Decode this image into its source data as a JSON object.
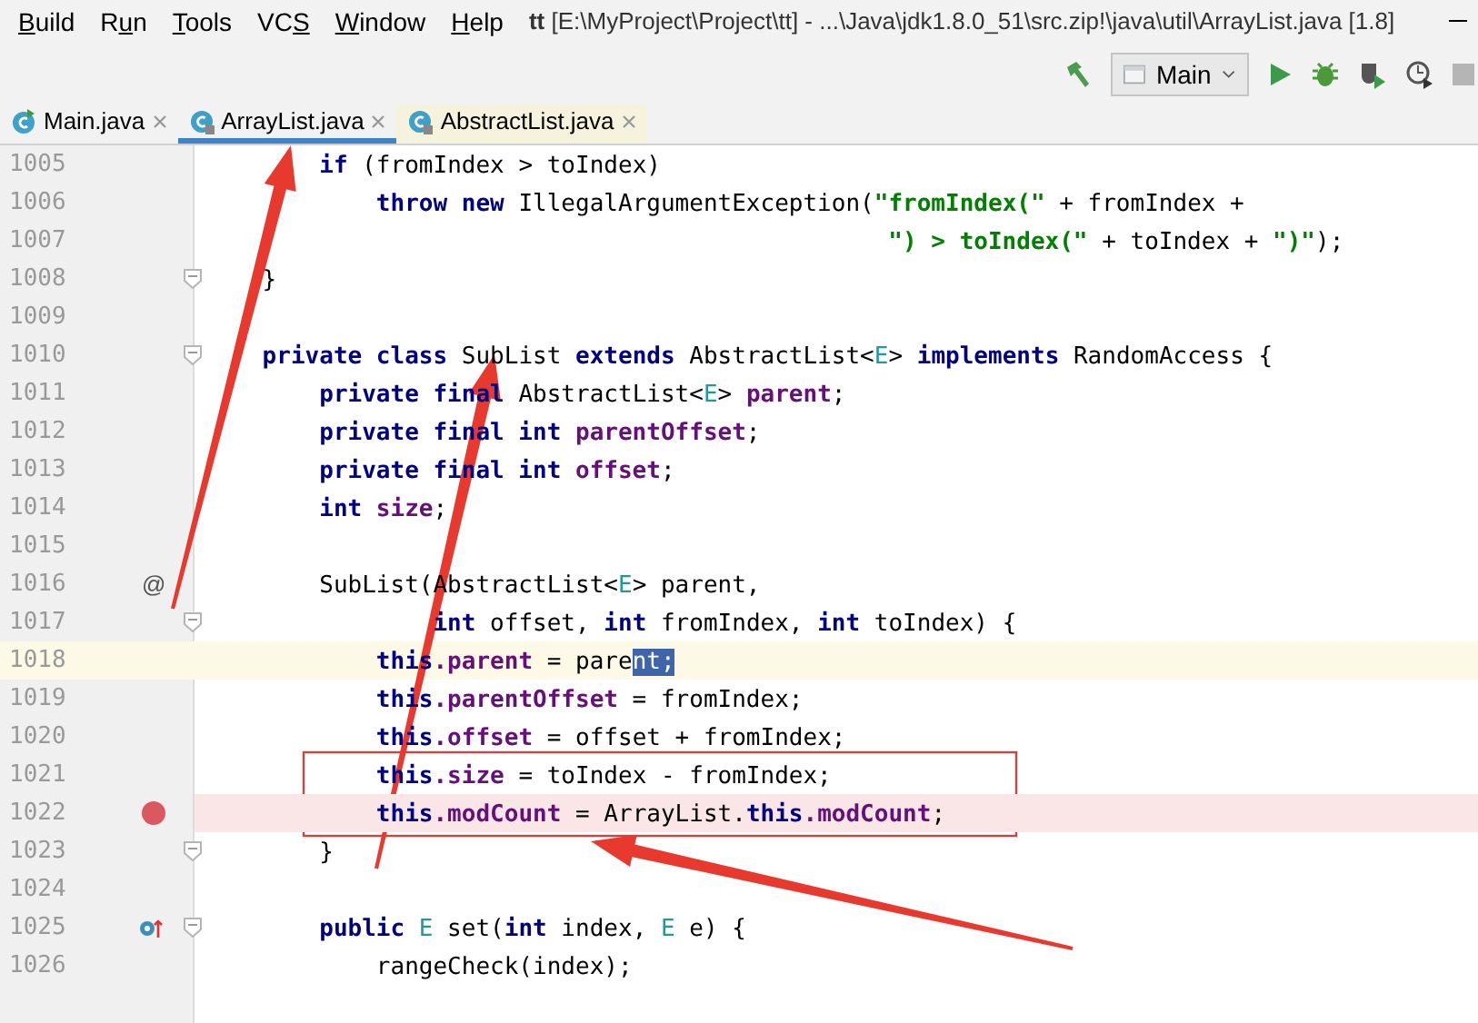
{
  "menu": [
    {
      "key": "B",
      "post": "uild"
    },
    {
      "pre": "R",
      "key": "u",
      "post": "n"
    },
    {
      "key": "T",
      "post": "ools"
    },
    {
      "pre": "VC",
      "key": "S"
    },
    {
      "key": "W",
      "post": "indow"
    },
    {
      "key": "H",
      "post": "elp"
    }
  ],
  "window": {
    "title": "**tt** [E:\\MyProject\\Project\\tt] - ...\\Java\\jdk1.8.0_51\\src.zip!\\java\\util\\ArrayList.java [1.8]"
  },
  "toolbar": {
    "run_configuration": "Main"
  },
  "tabs": [
    {
      "label": "Main.java",
      "kind": "main",
      "selected": false,
      "library": false
    },
    {
      "label": "ArrayList.java",
      "kind": "class",
      "selected": true,
      "library": true
    },
    {
      "label": "AbstractList.java",
      "kind": "class",
      "selected": false,
      "library": true
    }
  ],
  "editor": {
    "lines": [
      {
        "number": "1005",
        "tokens": [
          {
            "kind": "keyword",
            "text": "        if"
          },
          {
            "kind": "plain",
            "text": " (fromIndex > toIndex)"
          }
        ]
      },
      {
        "number": "1006",
        "tokens": [
          {
            "kind": "keyword",
            "text": "            throw new"
          },
          {
            "kind": "plain",
            "text": " IllegalArgumentException("
          },
          {
            "kind": "string",
            "text": "\"fromIndex(\""
          },
          {
            "kind": "plain",
            "text": " + fromIndex +"
          }
        ]
      },
      {
        "number": "1007",
        "tokens": [
          {
            "kind": "string",
            "text": "                                                \") > toIndex(\""
          },
          {
            "kind": "plain",
            "text": " + toIndex + "
          },
          {
            "kind": "string",
            "text": "\")\""
          },
          {
            "kind": "plain",
            "text": ");"
          }
        ]
      },
      {
        "number": "1008",
        "fold": true,
        "tokens": [
          {
            "kind": "plain",
            "text": "    }"
          }
        ]
      },
      {
        "number": "1009"
      },
      {
        "number": "1010",
        "fold": true,
        "tokens": [
          {
            "kind": "keyword",
            "text": "    private class"
          },
          {
            "kind": "plain",
            "text": " SubList "
          },
          {
            "kind": "keyword",
            "text": "extends"
          },
          {
            "kind": "plain",
            "text": " AbstractList<"
          },
          {
            "kind": "typeparam",
            "text": "E"
          },
          {
            "kind": "plain",
            "text": "> "
          },
          {
            "kind": "keyword",
            "text": "implements"
          },
          {
            "kind": "plain",
            "text": " RandomAccess {"
          }
        ]
      },
      {
        "number": "1011",
        "tokens": [
          {
            "kind": "keyword",
            "text": "        private final"
          },
          {
            "kind": "plain",
            "text": " AbstractList<"
          },
          {
            "kind": "typeparam",
            "text": "E"
          },
          {
            "kind": "plain",
            "text": "> "
          },
          {
            "kind": "field",
            "text": "parent"
          },
          {
            "kind": "plain",
            "text": ";"
          }
        ]
      },
      {
        "number": "1012",
        "tokens": [
          {
            "kind": "keyword",
            "text": "        private final int"
          },
          {
            "kind": "field",
            "text": " parentOffset"
          },
          {
            "kind": "plain",
            "text": ";"
          }
        ]
      },
      {
        "number": "1013",
        "tokens": [
          {
            "kind": "keyword",
            "text": "        private final int"
          },
          {
            "kind": "field",
            "text": " offset"
          },
          {
            "kind": "plain",
            "text": ";"
          }
        ]
      },
      {
        "number": "1014",
        "tokens": [
          {
            "kind": "keyword",
            "text": "        int"
          },
          {
            "kind": "field",
            "text": " size"
          },
          {
            "kind": "plain",
            "text": ";"
          }
        ]
      },
      {
        "number": "1015"
      },
      {
        "number": "1016",
        "gutter_text": "@",
        "tokens": [
          {
            "kind": "plain",
            "text": "        SubList(AbstractList<"
          },
          {
            "kind": "typeparam",
            "text": "E"
          },
          {
            "kind": "plain",
            "text": "> parent,"
          }
        ]
      },
      {
        "number": "1017",
        "fold": true,
        "tokens": [
          {
            "kind": "keyword",
            "text": "                int"
          },
          {
            "kind": "plain",
            "text": " offset, "
          },
          {
            "kind": "keyword",
            "text": "int"
          },
          {
            "kind": "plain",
            "text": " fromIndex, "
          },
          {
            "kind": "keyword",
            "text": "int"
          },
          {
            "kind": "plain",
            "text": " toIndex) {"
          }
        ]
      },
      {
        "number": "1018",
        "current": true,
        "tokens": [
          {
            "kind": "keyword",
            "text": "            this"
          },
          {
            "kind": "field",
            "text": ".parent"
          },
          {
            "kind": "plain",
            "text": " = pare"
          },
          {
            "kind": "plain",
            "text": "nt;",
            "selected": true
          }
        ]
      },
      {
        "number": "1019",
        "tokens": [
          {
            "kind": "keyword",
            "text": "            this"
          },
          {
            "kind": "field",
            "text": ".parentOffset"
          },
          {
            "kind": "plain",
            "text": " = fromIndex;"
          }
        ]
      },
      {
        "number": "1020",
        "tokens": [
          {
            "kind": "keyword",
            "text": "            this"
          },
          {
            "kind": "field",
            "text": ".offset"
          },
          {
            "kind": "plain",
            "text": " = offset + fromIndex;"
          }
        ]
      },
      {
        "number": "1021",
        "tokens": [
          {
            "kind": "keyword",
            "text": "            this"
          },
          {
            "kind": "field",
            "text": ".size"
          },
          {
            "kind": "plain",
            "text": " = toIndex - fromIndex;"
          }
        ]
      },
      {
        "number": "1022",
        "breakpoint": true,
        "tokens": [
          {
            "kind": "keyword",
            "text": "            this"
          },
          {
            "kind": "field",
            "text": ".modCount"
          },
          {
            "kind": "plain",
            "text": " = ArrayList."
          },
          {
            "kind": "keyword",
            "text": "this"
          },
          {
            "kind": "field",
            "text": ".modCount"
          },
          {
            "kind": "plain",
            "text": ";"
          }
        ]
      },
      {
        "number": "1023",
        "fold": true,
        "tokens": [
          {
            "kind": "plain",
            "text": "        }"
          }
        ]
      },
      {
        "number": "1024"
      },
      {
        "number": "1025",
        "fold": true,
        "implemented": true,
        "tokens": [
          {
            "kind": "keyword",
            "text": "        public"
          },
          {
            "kind": "typeparam",
            "text": " E"
          },
          {
            "kind": "plain",
            "text": " set("
          },
          {
            "kind": "keyword",
            "text": "int"
          },
          {
            "kind": "plain",
            "text": " index, "
          },
          {
            "kind": "typeparam",
            "text": "E"
          },
          {
            "kind": "plain",
            "text": " e) {"
          }
        ]
      },
      {
        "number": "1026",
        "tokens": [
          {
            "kind": "plain",
            "text": "            rangeCheck(index);"
          }
        ]
      }
    ]
  }
}
